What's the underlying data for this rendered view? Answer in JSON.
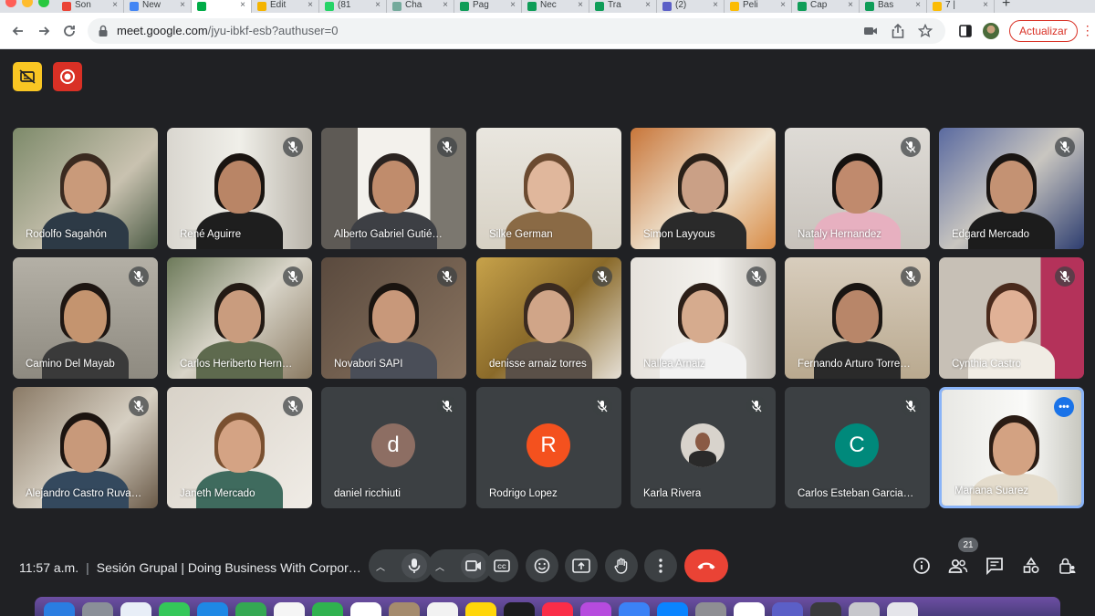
{
  "browser": {
    "tabs": [
      {
        "label": "Son",
        "favicon": "gmail-icon",
        "color": "#ea4335"
      },
      {
        "label": "New",
        "favicon": "calendar-icon",
        "color": "#4285f4"
      },
      {
        "label": "",
        "favicon": "meet-icon",
        "color": "#00ac47",
        "active": true
      },
      {
        "label": "Edit",
        "favicon": "edit-icon",
        "color": "#f4b400"
      },
      {
        "label": "(81",
        "favicon": "whatsapp-icon",
        "color": "#25d366"
      },
      {
        "label": "Cha",
        "favicon": "chatgpt-icon",
        "color": "#74aa9c"
      },
      {
        "label": "Pag",
        "favicon": "sheets-icon",
        "color": "#0f9d58"
      },
      {
        "label": "Nec",
        "favicon": "sheets-icon",
        "color": "#0f9d58"
      },
      {
        "label": "Tra",
        "favicon": "sheets-icon",
        "color": "#0f9d58"
      },
      {
        "label": "(2)",
        "favicon": "teams-icon",
        "color": "#5b5fc7"
      },
      {
        "label": "Peli",
        "favicon": "drive-icon",
        "color": "#fbbc04"
      },
      {
        "label": "Cap",
        "favicon": "sheets-icon",
        "color": "#0f9d58"
      },
      {
        "label": "Bas",
        "favicon": "sheets-icon",
        "color": "#0f9d58"
      },
      {
        "label": "7 |",
        "favicon": "drive-icon",
        "color": "#fbbc04"
      }
    ],
    "url_host": "meet.google.com",
    "url_path": "/jyu-ibkf-esb?authuser=0",
    "update_label": "Actualizar"
  },
  "meet": {
    "participants": [
      {
        "name": "Rodolfo Sagahón",
        "muted": false
      },
      {
        "name": "René Aguirre",
        "muted": true
      },
      {
        "name": "Alberto Gabriel Gutié…",
        "muted": true
      },
      {
        "name": "Silke German",
        "muted": false
      },
      {
        "name": "Simon Layyous",
        "muted": false
      },
      {
        "name": "Nataly Hernandez",
        "muted": true
      },
      {
        "name": "Edgard Mercado",
        "muted": true
      },
      {
        "name": "Camino Del Mayab",
        "muted": true
      },
      {
        "name": "Carlos Heriberto Hern…",
        "muted": true
      },
      {
        "name": "Novabori SAPI",
        "muted": true
      },
      {
        "name": "denisse arnaiz torres",
        "muted": true
      },
      {
        "name": "Nallea Arnaiz",
        "muted": true
      },
      {
        "name": "Fernando Arturo Torre…",
        "muted": true
      },
      {
        "name": "Cynthia Castro",
        "muted": true
      },
      {
        "name": "Alejandro Castro Ruva…",
        "muted": true
      },
      {
        "name": "Janeth Mercado",
        "muted": true
      },
      {
        "name": "daniel ricchiuti",
        "muted": true,
        "initial": "d"
      },
      {
        "name": "Rodrigo Lopez",
        "muted": true,
        "initial": "R"
      },
      {
        "name": "Karla Rivera",
        "muted": true
      },
      {
        "name": "Carlos Esteban Garcia…",
        "muted": true,
        "initial": "C"
      },
      {
        "name": "Mariana Suarez",
        "muted": false
      }
    ],
    "time": "11:57 a.m.",
    "meeting_title": "Sesión Grupal | Doing Business With Corpor…",
    "people_count": "21",
    "colors": {
      "background": "#202124",
      "hangup": "#ea4335",
      "accent": "#8ab4f8"
    }
  }
}
